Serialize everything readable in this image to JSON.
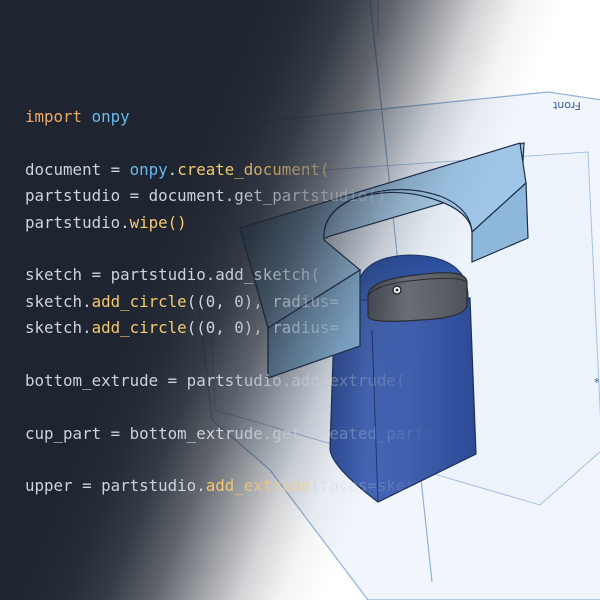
{
  "viewport": {
    "front_plane_label": "Front"
  },
  "code_lines": [
    {
      "parts": [
        {
          "t": "import",
          "c": "kw"
        },
        {
          "t": " "
        },
        {
          "t": "onpy",
          "c": "mod"
        }
      ]
    },
    {
      "parts": []
    },
    {
      "parts": [
        {
          "t": "document = "
        },
        {
          "t": "onpy",
          "c": "mod"
        },
        {
          "t": "."
        },
        {
          "t": "create_document(",
          "c": "fn"
        }
      ]
    },
    {
      "parts": [
        {
          "t": "partstudio = document.get_partstudio()"
        }
      ]
    },
    {
      "parts": [
        {
          "t": "partstudio."
        },
        {
          "t": "wipe()",
          "c": "fn"
        }
      ]
    },
    {
      "parts": []
    },
    {
      "parts": [
        {
          "t": "sketch = partstudio.add_sketch("
        }
      ]
    },
    {
      "parts": [
        {
          "t": "sketch."
        },
        {
          "t": "add_circle",
          "c": "fn"
        },
        {
          "t": "((0, 0), radius="
        }
      ]
    },
    {
      "parts": [
        {
          "t": "sketch."
        },
        {
          "t": "add_circle",
          "c": "fn"
        },
        {
          "t": "((0, 0), radius="
        }
      ]
    },
    {
      "parts": []
    },
    {
      "parts": [
        {
          "t": "bottom_extrude = partstudio.add_extrude("
        }
      ]
    },
    {
      "parts": []
    },
    {
      "parts": [
        {
          "t": "cup_part = bottom_extrude.get_created_parts("
        }
      ]
    },
    {
      "parts": []
    },
    {
      "parts": [
        {
          "t": "upper = partstudio."
        },
        {
          "t": "add_extrude",
          "c": "fn"
        },
        {
          "t": "(faces=sketch.faces"
        }
      ]
    }
  ]
}
